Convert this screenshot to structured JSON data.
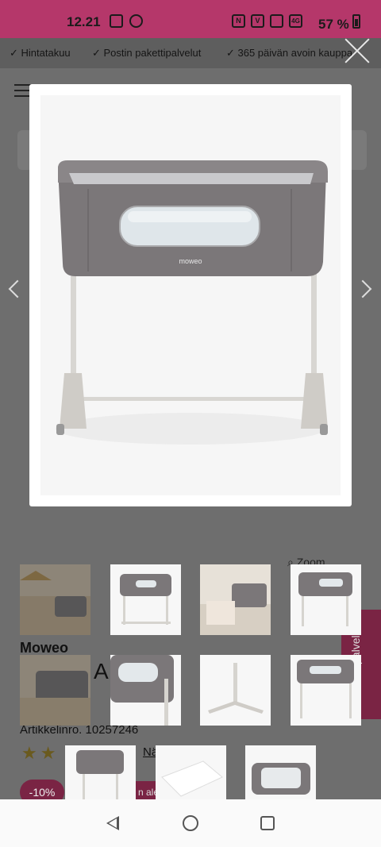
{
  "status_bar": {
    "time": "12.21",
    "battery": "57 %",
    "network": "4G",
    "icons": [
      "sim-icon",
      "whatsapp-icon",
      "nfc-icon",
      "volte-icon",
      "vibrate-icon",
      "signal-icon",
      "battery-icon"
    ]
  },
  "usp": [
    "✓ Hintatakuu",
    "✓ Postin pakettipalvelut",
    "✓ 365 päivän avoin kauppa"
  ],
  "page": {
    "zoom_label": "Zoom",
    "brand": "Moweo",
    "title_fragment": "A vu   ar",
    "article_no": "Artikkelinro. 10257246",
    "stars": "★★",
    "reviews_fragment": "Näytä arvos",
    "discount": "-10%",
    "save_badge": "n ale",
    "customer_service": "Asiakaspalvelu"
  },
  "lightbox": {
    "product_logo": "moweo"
  },
  "colors": {
    "status_bar": "#b5376a",
    "accent": "#7a2444",
    "overlay": "#6e6e6e"
  }
}
